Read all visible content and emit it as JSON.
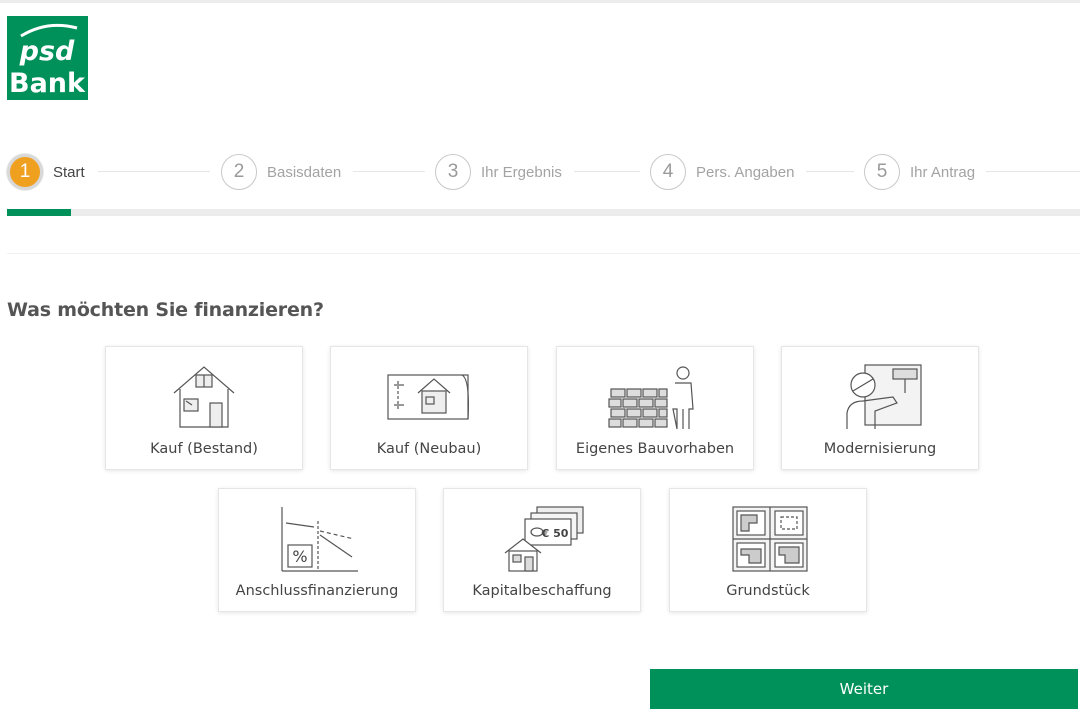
{
  "logo": {
    "line1": "psd",
    "line2": "Bank",
    "color": "#00915a"
  },
  "steps": [
    {
      "num": "1",
      "label": "Start",
      "active": true
    },
    {
      "num": "2",
      "label": "Basisdaten",
      "active": false
    },
    {
      "num": "3",
      "label": "Ihr Ergebnis",
      "active": false
    },
    {
      "num": "4",
      "label": "Pers. Angaben",
      "active": false
    },
    {
      "num": "5",
      "label": "Ihr Antrag",
      "active": false
    }
  ],
  "progress_fraction": 0.06,
  "question": "Was möchten Sie finanzieren?",
  "options": [
    {
      "label": "Kauf (Bestand)",
      "icon": "house-existing-icon"
    },
    {
      "label": "Kauf (Neubau)",
      "icon": "house-blueprint-icon"
    },
    {
      "label": "Eigenes Bauvorhaben",
      "icon": "builder-bricks-icon"
    },
    {
      "label": "Modernisierung",
      "icon": "painter-roller-icon"
    },
    {
      "label": "Anschlussfinanzierung",
      "icon": "percent-chart-icon"
    },
    {
      "label": "Kapitalbeschaffung",
      "icon": "house-money-icon"
    },
    {
      "label": "Grundstück",
      "icon": "land-plot-icon"
    }
  ],
  "weiter_label": "Weiter",
  "colors": {
    "accent": "#00915a",
    "active_step": "#f0a01f"
  }
}
